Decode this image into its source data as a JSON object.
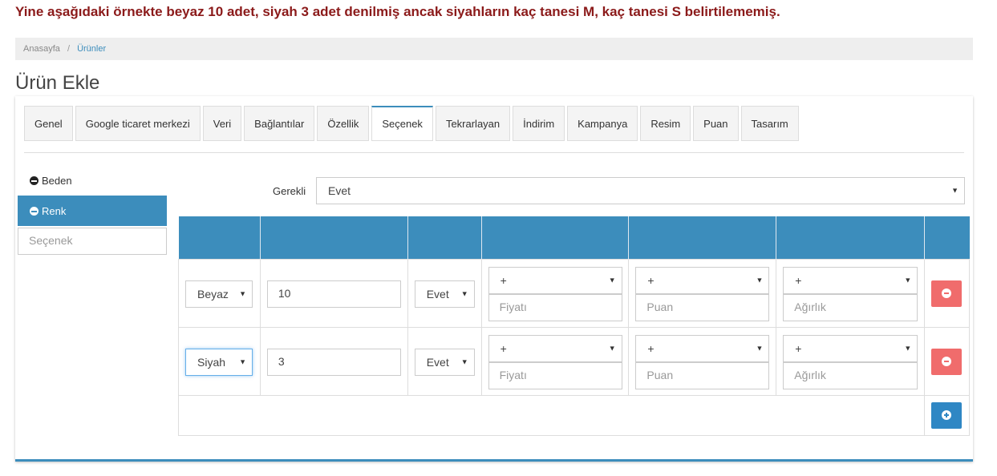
{
  "notice": "Yine aşağıdaki örnekte beyaz 10 adet, siyah 3 adet denilmiş ancak siyahların kaç tanesi M, kaç tanesi S belirtilememiş.",
  "breadcrumb": {
    "home": "Anasayfa",
    "separator": "/",
    "current": "Ürünler"
  },
  "page_title": "Ürün Ekle",
  "tabs": [
    "Genel",
    "Google ticaret merkezi",
    "Veri",
    "Bağlantılar",
    "Özellik",
    "Seçenek",
    "Tekrarlayan",
    "İndirim",
    "Kampanya",
    "Resim",
    "Puan",
    "Tasarım"
  ],
  "active_tab": "Seçenek",
  "sidebar": {
    "items": [
      {
        "label": "Beden",
        "icon": "minus-circle-icon"
      },
      {
        "label": "Renk",
        "icon": "minus-circle-icon"
      }
    ],
    "input_placeholder": "Seçenek"
  },
  "required": {
    "label": "Gerekli",
    "value": "Evet"
  },
  "rows": [
    {
      "option": "Beyaz",
      "quantity": "10",
      "subtract": "Evet",
      "price_prefix": "+",
      "price_placeholder": "Fiyatı",
      "points_prefix": "+",
      "points_placeholder": "Puan",
      "weight_prefix": "+",
      "weight_placeholder": "Ağırlık"
    },
    {
      "option": "Siyah",
      "quantity": "3",
      "subtract": "Evet",
      "price_prefix": "+",
      "price_placeholder": "Fiyatı",
      "points_prefix": "+",
      "points_placeholder": "Puan",
      "weight_prefix": "+",
      "weight_placeholder": "Ağırlık"
    }
  ],
  "colors": {
    "accent": "#3c8dbc",
    "danger": "#f06c6c",
    "notice": "#8b1a1a"
  }
}
